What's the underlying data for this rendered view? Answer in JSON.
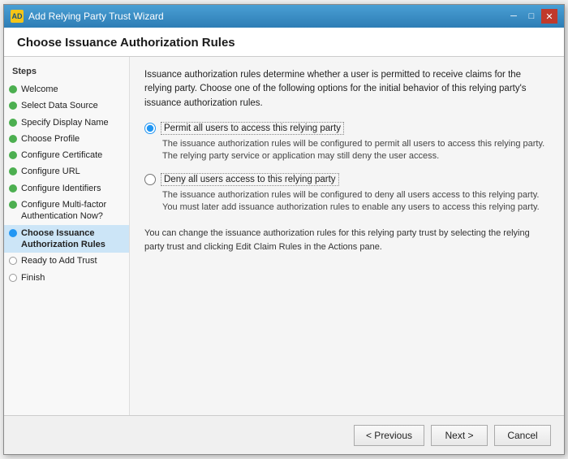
{
  "window": {
    "title": "Add Relying Party Trust Wizard",
    "icon_label": "AD"
  },
  "page": {
    "title": "Choose Issuance Authorization Rules"
  },
  "sidebar": {
    "label": "Steps",
    "items": [
      {
        "id": "welcome",
        "label": "Welcome",
        "dot": "green",
        "active": false
      },
      {
        "id": "select-data-source",
        "label": "Select Data Source",
        "dot": "green",
        "active": false
      },
      {
        "id": "specify-display-name",
        "label": "Specify Display Name",
        "dot": "green",
        "active": false
      },
      {
        "id": "choose-profile",
        "label": "Choose Profile",
        "dot": "green",
        "active": false
      },
      {
        "id": "configure-certificate",
        "label": "Configure Certificate",
        "dot": "green",
        "active": false
      },
      {
        "id": "configure-url",
        "label": "Configure URL",
        "dot": "green",
        "active": false
      },
      {
        "id": "configure-identifiers",
        "label": "Configure Identifiers",
        "dot": "green",
        "active": false
      },
      {
        "id": "configure-mfa",
        "label": "Configure Multi-factor Authentication Now?",
        "dot": "green",
        "active": false
      },
      {
        "id": "choose-issuance",
        "label": "Choose Issuance Authorization Rules",
        "dot": "blue",
        "active": true
      },
      {
        "id": "ready-to-add",
        "label": "Ready to Add Trust",
        "dot": "white",
        "active": false
      },
      {
        "id": "finish",
        "label": "Finish",
        "dot": "white",
        "active": false
      }
    ]
  },
  "main": {
    "description": "Issuance authorization rules determine whether a user is permitted to receive claims for the relying party. Choose one of the following options for the initial behavior of this relying party's issuance authorization rules.",
    "option1": {
      "label": "Permit all users to access this relying party",
      "description": "The issuance authorization rules will be configured to permit all users to access this relying party. The relying party service or application may still deny the user access.",
      "selected": true
    },
    "option2": {
      "label": "Deny all users access to this relying party",
      "description": "The issuance authorization rules will be configured to deny all users access to this relying party. You must later add issuance authorization rules to enable any users to access this relying party.",
      "selected": false
    },
    "note": "You can change the issuance authorization rules for this relying party trust by selecting the relying party trust and clicking Edit Claim Rules in the Actions pane."
  },
  "footer": {
    "previous_label": "< Previous",
    "next_label": "Next >",
    "cancel_label": "Cancel"
  },
  "title_controls": {
    "minimize": "─",
    "maximize": "□",
    "close": "✕"
  }
}
